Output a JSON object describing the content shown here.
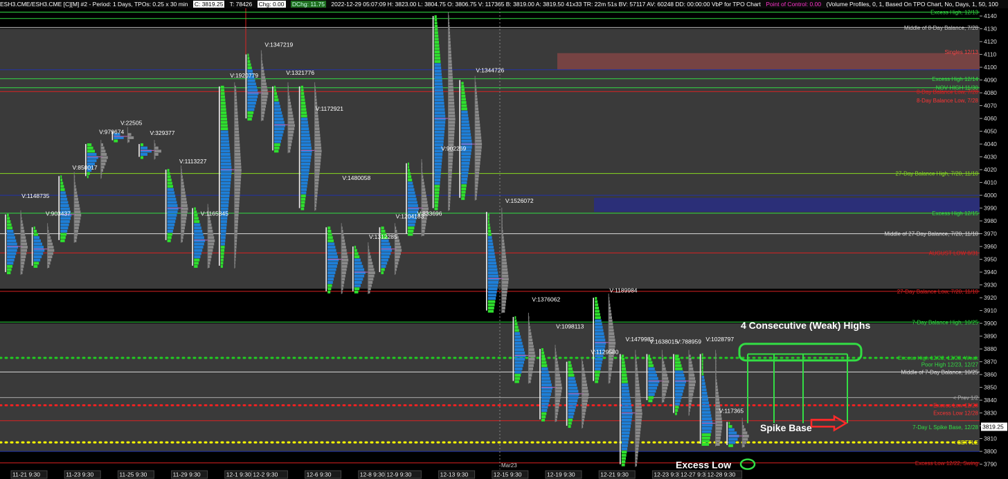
{
  "header": {
    "symbol": "ESH3.CME/ESH3.CME [C][M]  #2 - Period: 1 Days, TPOs: 0.25 x 30 min",
    "last": "C: 3819.25",
    "trades": "T: 78426",
    "chg": "Chg: 0.00",
    "dchg": "DChg: 11.75",
    "ohlc": "2022-12-29 05:07:09 H: 3823.00 L: 3804.75 O: 3806.75 V: 117365 B: 3819.00 A: 3819.50 41x33 TR: 22m 51s BV: 57117 AV: 60248 DD: 00:00:00 VbP for TPO Chart",
    "poc": "Point of Control: 0.00",
    "study": "(Volume Profiles, 0, 1, Based On TPO Chart, No, Days, 1, 50, 100"
  },
  "colors": {
    "background": "#000000",
    "balance_zone": "#3d3d3d",
    "tpo_blue": "#1e7fd8",
    "tpo_green": "#2ee02e",
    "volume_profile": "#8a8a8a",
    "annotation_green": "#33dd44",
    "annotation_red": "#ff2a2a",
    "settle_dots": "#ffff00",
    "excess_dots": "#22cc22",
    "red_dots": "#ee2222"
  },
  "chart_data": {
    "type": "tpo-profile",
    "ylim": [
      3786,
      4146
    ],
    "y_ticks": [
      3790,
      3800,
      3810,
      3820,
      3830,
      3840,
      3850,
      3860,
      3870,
      3880,
      3890,
      3900,
      3910,
      3920,
      3930,
      3940,
      3950,
      3960,
      3970,
      3980,
      3990,
      4000,
      4010,
      4020,
      4030,
      4040,
      4050,
      4060,
      4070,
      4080,
      4090,
      4100,
      4110,
      4120,
      4130,
      4140
    ],
    "price_marker": "3819.25",
    "x_labels": [
      {
        "label": "11-21  9:30",
        "x": 0
      },
      {
        "label": "11-23  9:30",
        "x": 2
      },
      {
        "label": "11-25  9:30",
        "x": 4
      },
      {
        "label": "11-29  9:30",
        "x": 6
      },
      {
        "label": "12-1  9:30",
        "x": 8
      },
      {
        "label": "12-2  9:30",
        "x": 9
      },
      {
        "label": "12-6  9:30",
        "x": 11
      },
      {
        "label": "12-8  9:30",
        "x": 13
      },
      {
        "label": "12-9  9:30",
        "x": 14
      },
      {
        "label": "12-13  9:30",
        "x": 16
      },
      {
        "label": "12-15  9:30",
        "x": 18
      },
      {
        "label": "12-19  9:30",
        "x": 20
      },
      {
        "label": "12-21  9:30",
        "x": 22
      },
      {
        "label": "12-23  9:30",
        "x": 24
      },
      {
        "label": "12-27  9:30",
        "x": 25
      },
      {
        "label": "12-28  9:30",
        "x": 26
      }
    ],
    "divider_label": "Mar23",
    "sessions": [
      {
        "x": 0,
        "low": 3940,
        "high": 3985,
        "poc": 3960,
        "vol": "V:1148735",
        "vx": 0.6,
        "vy": 3998
      },
      {
        "x": 1,
        "low": 3945,
        "high": 3975,
        "poc": 3958,
        "vol": "V:903437",
        "vx": 1.5,
        "vy": 3984
      },
      {
        "x": 2,
        "low": 3965,
        "high": 4015,
        "poc": 3985,
        "vol": "V:850017",
        "vx": 2.5,
        "vy": 4020
      },
      {
        "x": 3,
        "low": 4015,
        "high": 4040,
        "poc": 4030,
        "vol": "V:979674",
        "vx": 3.5,
        "vy": 4048
      },
      {
        "x": 4,
        "low": 4043,
        "high": 4050,
        "poc": 4046,
        "vol": "V:22505",
        "vx": 4.3,
        "vy": 4055
      },
      {
        "x": 5,
        "low": 4030,
        "high": 4040,
        "poc": 4035,
        "vol": "V:329377",
        "vx": 5.4,
        "vy": 4047
      },
      {
        "x": 6,
        "low": 3965,
        "high": 4020,
        "poc": 3990,
        "vol": "V:1113227",
        "vx": 6.5,
        "vy": 4025
      },
      {
        "x": 7,
        "low": 3945,
        "high": 3990,
        "poc": 3965,
        "vol": "V:1165845",
        "vx": 7.3,
        "vy": 3984
      },
      {
        "x": 8,
        "low": 3945,
        "high": 4085,
        "poc": 4020,
        "vol": "V:1920779",
        "vx": 8.4,
        "vy": 4092
      },
      {
        "x": 9,
        "low": 4060,
        "high": 4110,
        "poc": 4080,
        "vol": "V:1347219",
        "vx": 9.7,
        "vy": 4116
      },
      {
        "x": 10,
        "low": 4035,
        "high": 4085,
        "poc": 4055,
        "vol": "V:1321776",
        "vx": 10.5,
        "vy": 4094
      },
      {
        "x": 11,
        "low": 3990,
        "high": 4085,
        "poc": 4035,
        "vol": "V:1172921",
        "vx": 11.6,
        "vy": 4066
      },
      {
        "x": 12,
        "low": 3925,
        "high": 3975,
        "poc": 3950,
        "vol": "V:1480058",
        "vx": 12.6,
        "vy": 4012
      },
      {
        "x": 13,
        "low": 3925,
        "high": 3960,
        "poc": 3940,
        "vol": "V:1312285",
        "vx": 13.6,
        "vy": 3966
      },
      {
        "x": 14,
        "low": 3940,
        "high": 3975,
        "poc": 3958,
        "vol": "V:1204183",
        "vx": 14.6,
        "vy": 3982
      },
      {
        "x": 15,
        "low": 3970,
        "high": 4025,
        "poc": 3990,
        "vol": "V:833696",
        "vx": 15.4,
        "vy": 3984
      },
      {
        "x": 16,
        "low": 3990,
        "high": 4140,
        "poc": 4060,
        "vol": "V:902269",
        "vx": 16.3,
        "vy": 4035
      },
      {
        "x": 17,
        "low": 3998,
        "high": 4090,
        "poc": 4040,
        "vol": "V:1344726",
        "vx": 17.6,
        "vy": 4096
      },
      {
        "x": 18,
        "low": 3910,
        "high": 3987,
        "poc": 3935,
        "vol": "V:1526072",
        "vx": 18.7,
        "vy": 3994
      },
      {
        "x": 19,
        "low": 3855,
        "high": 3905,
        "poc": 3875,
        "vol": "V:1376062",
        "vx": 19.7,
        "vy": 3917
      },
      {
        "x": 20,
        "low": 3825,
        "high": 3880,
        "poc": 3850,
        "vol": "V:1098113",
        "vx": 20.6,
        "vy": 3896
      },
      {
        "x": 21,
        "low": 3820,
        "high": 3870,
        "poc": 3845,
        "vol": "V:1129580",
        "vx": 21.9,
        "vy": 3876
      },
      {
        "x": 22,
        "low": 3855,
        "high": 3920,
        "poc": 3885,
        "vol": "V:1189984",
        "vx": 22.6,
        "vy": 3924
      },
      {
        "x": 23,
        "low": 3790,
        "high": 3876,
        "poc": 3830,
        "vol": "V:1479982",
        "vx": 23.2,
        "vy": 3886
      },
      {
        "x": 24,
        "low": 3840,
        "high": 3876,
        "poc": 3855,
        "vol": "V:1638015",
        "vx": 24.1,
        "vy": 3884
      },
      {
        "x": 25,
        "low": 3830,
        "high": 3876,
        "poc": 3855,
        "vol": "V:788959",
        "vx": 25.1,
        "vy": 3884
      },
      {
        "x": 26,
        "low": 3806,
        "high": 3876,
        "poc": 3822,
        "vol": "V:1028797",
        "vx": 26.2,
        "vy": 3886
      },
      {
        "x": 27,
        "low": 3805,
        "high": 3823,
        "poc": 3812,
        "vol": "V:117365",
        "vx": 26.7,
        "vy": 3830
      }
    ],
    "zones": [
      {
        "low": 3927,
        "high": 4130,
        "x0": 0,
        "x1": 1415,
        "color": "#3d3d3d",
        "opacity": 0.95
      },
      {
        "low": 3800,
        "high": 3900,
        "x0": 0,
        "x1": 1415,
        "color": "#3d3d3d",
        "opacity": 0.95
      },
      {
        "low": 4098,
        "high": 4111,
        "x0": 805,
        "x1": 1415,
        "color": "#a84a4a",
        "opacity": 0.55
      },
      {
        "low": 3987,
        "high": 3998,
        "x0": 858,
        "x1": 1415,
        "color": "#2a2f80",
        "opacity": 0.9
      }
    ],
    "lines": [
      {
        "price": 4143,
        "color": "#33dd44",
        "label": "Excess High, 12/13"
      },
      {
        "price": 4138,
        "color": "#33dd44",
        "label": ""
      },
      {
        "price": 4131,
        "color": "#cccccc",
        "label": "Middle of 8-Day Balance, 7/28"
      },
      {
        "price": 4098,
        "color": "#2233aa",
        "label": ""
      },
      {
        "price": 4091,
        "color": "#33dd44",
        "label": "Excess High 12/14"
      },
      {
        "price": 4084,
        "color": "#33dd44",
        "label": "NOV HIGH 11/30"
      },
      {
        "price": 4081,
        "color": "#dd2222",
        "label": "8-Day Balance Low, 7/28"
      },
      {
        "price": 4017,
        "color": "#88dd22",
        "label": "27-Day Balance High, 7/20, 11/10"
      },
      {
        "price": 4000,
        "color": "#2233aa",
        "label": ""
      },
      {
        "price": 3986,
        "color": "#33dd44",
        "label": "Excess High 12/15"
      },
      {
        "price": 3970,
        "color": "#dddddd",
        "label": "Middle of 27-Day Balance, 7/20, 11/10"
      },
      {
        "price": 3955,
        "color": "#dd2222",
        "label": "AUGUST LOW 8/31"
      },
      {
        "price": 3925,
        "color": "#dd2222",
        "label": "27-Day Balance Low, 7/20, 11/10"
      },
      {
        "price": 3901,
        "color": "#33dd44",
        "label": "7-Day Balance High, 10/25"
      },
      {
        "price": 3862,
        "color": "#dddddd",
        "label": "Middle of 7-Day Balance, 10/25"
      },
      {
        "price": 3842,
        "color": "#aaaaaa",
        "label": "< Prev 1/2"
      },
      {
        "price": 3824,
        "color": "#dd2222",
        "label": ""
      },
      {
        "price": 3800,
        "color": "#2233aa",
        "label": ""
      },
      {
        "price": 3791,
        "color": "#dd2222",
        "label": "Excess Low 12/22, Swing"
      }
    ],
    "dotted_lines": [
      {
        "price": 3873,
        "color": "#22cc22",
        "label": "Excess High 12/22, 12/28, Weak"
      },
      {
        "price": 3836,
        "color": "#ee2222",
        "label": "Excess Low 12/28"
      },
      {
        "price": 3807,
        "color": "#ffff00",
        "label": "< SETTLE"
      }
    ],
    "right_labels": [
      {
        "price": 4132,
        "text": "Singles 12/13",
        "color": "#ff4444",
        "yoff": 4112
      },
      {
        "price": 4066,
        "text": "8-Day Balance Low, 7/28",
        "color": "#ff3333",
        "yoff": 4074
      },
      {
        "price": 3869,
        "text": "Poor High 12/23, 12/27",
        "color": "#33dd44",
        "yoff": 3868
      },
      {
        "price": 3820,
        "text": "7-Day  L Spike Base, 12/28",
        "color": "#33dd44",
        "yoff": 3819
      },
      {
        "price": 3829,
        "text": "Excess Low 12/28",
        "color": "#ff3333",
        "yoff": 3830
      }
    ],
    "annotations": {
      "weak_highs": "4 Consecutive (Weak) Highs",
      "spike_base": "Spike Base",
      "excess_low": "Excess Low"
    }
  }
}
